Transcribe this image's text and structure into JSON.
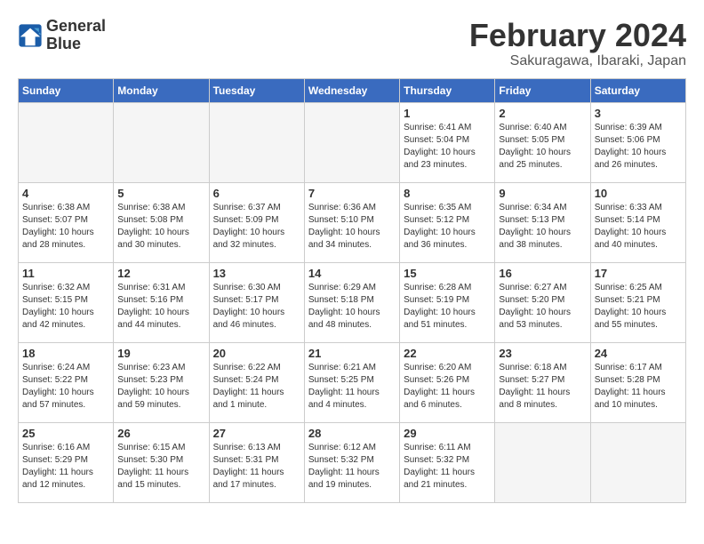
{
  "header": {
    "logo_line1": "General",
    "logo_line2": "Blue",
    "month": "February 2024",
    "location": "Sakuragawa, Ibaraki, Japan"
  },
  "weekdays": [
    "Sunday",
    "Monday",
    "Tuesday",
    "Wednesday",
    "Thursday",
    "Friday",
    "Saturday"
  ],
  "weeks": [
    [
      {
        "day": "",
        "empty": true
      },
      {
        "day": "",
        "empty": true
      },
      {
        "day": "",
        "empty": true
      },
      {
        "day": "",
        "empty": true
      },
      {
        "day": "1",
        "line1": "Sunrise: 6:41 AM",
        "line2": "Sunset: 5:04 PM",
        "line3": "Daylight: 10 hours",
        "line4": "and 23 minutes."
      },
      {
        "day": "2",
        "line1": "Sunrise: 6:40 AM",
        "line2": "Sunset: 5:05 PM",
        "line3": "Daylight: 10 hours",
        "line4": "and 25 minutes."
      },
      {
        "day": "3",
        "line1": "Sunrise: 6:39 AM",
        "line2": "Sunset: 5:06 PM",
        "line3": "Daylight: 10 hours",
        "line4": "and 26 minutes."
      }
    ],
    [
      {
        "day": "4",
        "line1": "Sunrise: 6:38 AM",
        "line2": "Sunset: 5:07 PM",
        "line3": "Daylight: 10 hours",
        "line4": "and 28 minutes."
      },
      {
        "day": "5",
        "line1": "Sunrise: 6:38 AM",
        "line2": "Sunset: 5:08 PM",
        "line3": "Daylight: 10 hours",
        "line4": "and 30 minutes."
      },
      {
        "day": "6",
        "line1": "Sunrise: 6:37 AM",
        "line2": "Sunset: 5:09 PM",
        "line3": "Daylight: 10 hours",
        "line4": "and 32 minutes."
      },
      {
        "day": "7",
        "line1": "Sunrise: 6:36 AM",
        "line2": "Sunset: 5:10 PM",
        "line3": "Daylight: 10 hours",
        "line4": "and 34 minutes."
      },
      {
        "day": "8",
        "line1": "Sunrise: 6:35 AM",
        "line2": "Sunset: 5:12 PM",
        "line3": "Daylight: 10 hours",
        "line4": "and 36 minutes."
      },
      {
        "day": "9",
        "line1": "Sunrise: 6:34 AM",
        "line2": "Sunset: 5:13 PM",
        "line3": "Daylight: 10 hours",
        "line4": "and 38 minutes."
      },
      {
        "day": "10",
        "line1": "Sunrise: 6:33 AM",
        "line2": "Sunset: 5:14 PM",
        "line3": "Daylight: 10 hours",
        "line4": "and 40 minutes."
      }
    ],
    [
      {
        "day": "11",
        "line1": "Sunrise: 6:32 AM",
        "line2": "Sunset: 5:15 PM",
        "line3": "Daylight: 10 hours",
        "line4": "and 42 minutes."
      },
      {
        "day": "12",
        "line1": "Sunrise: 6:31 AM",
        "line2": "Sunset: 5:16 PM",
        "line3": "Daylight: 10 hours",
        "line4": "and 44 minutes."
      },
      {
        "day": "13",
        "line1": "Sunrise: 6:30 AM",
        "line2": "Sunset: 5:17 PM",
        "line3": "Daylight: 10 hours",
        "line4": "and 46 minutes."
      },
      {
        "day": "14",
        "line1": "Sunrise: 6:29 AM",
        "line2": "Sunset: 5:18 PM",
        "line3": "Daylight: 10 hours",
        "line4": "and 48 minutes."
      },
      {
        "day": "15",
        "line1": "Sunrise: 6:28 AM",
        "line2": "Sunset: 5:19 PM",
        "line3": "Daylight: 10 hours",
        "line4": "and 51 minutes."
      },
      {
        "day": "16",
        "line1": "Sunrise: 6:27 AM",
        "line2": "Sunset: 5:20 PM",
        "line3": "Daylight: 10 hours",
        "line4": "and 53 minutes."
      },
      {
        "day": "17",
        "line1": "Sunrise: 6:25 AM",
        "line2": "Sunset: 5:21 PM",
        "line3": "Daylight: 10 hours",
        "line4": "and 55 minutes."
      }
    ],
    [
      {
        "day": "18",
        "line1": "Sunrise: 6:24 AM",
        "line2": "Sunset: 5:22 PM",
        "line3": "Daylight: 10 hours",
        "line4": "and 57 minutes."
      },
      {
        "day": "19",
        "line1": "Sunrise: 6:23 AM",
        "line2": "Sunset: 5:23 PM",
        "line3": "Daylight: 10 hours",
        "line4": "and 59 minutes."
      },
      {
        "day": "20",
        "line1": "Sunrise: 6:22 AM",
        "line2": "Sunset: 5:24 PM",
        "line3": "Daylight: 11 hours",
        "line4": "and 1 minute."
      },
      {
        "day": "21",
        "line1": "Sunrise: 6:21 AM",
        "line2": "Sunset: 5:25 PM",
        "line3": "Daylight: 11 hours",
        "line4": "and 4 minutes."
      },
      {
        "day": "22",
        "line1": "Sunrise: 6:20 AM",
        "line2": "Sunset: 5:26 PM",
        "line3": "Daylight: 11 hours",
        "line4": "and 6 minutes."
      },
      {
        "day": "23",
        "line1": "Sunrise: 6:18 AM",
        "line2": "Sunset: 5:27 PM",
        "line3": "Daylight: 11 hours",
        "line4": "and 8 minutes."
      },
      {
        "day": "24",
        "line1": "Sunrise: 6:17 AM",
        "line2": "Sunset: 5:28 PM",
        "line3": "Daylight: 11 hours",
        "line4": "and 10 minutes."
      }
    ],
    [
      {
        "day": "25",
        "line1": "Sunrise: 6:16 AM",
        "line2": "Sunset: 5:29 PM",
        "line3": "Daylight: 11 hours",
        "line4": "and 12 minutes."
      },
      {
        "day": "26",
        "line1": "Sunrise: 6:15 AM",
        "line2": "Sunset: 5:30 PM",
        "line3": "Daylight: 11 hours",
        "line4": "and 15 minutes."
      },
      {
        "day": "27",
        "line1": "Sunrise: 6:13 AM",
        "line2": "Sunset: 5:31 PM",
        "line3": "Daylight: 11 hours",
        "line4": "and 17 minutes."
      },
      {
        "day": "28",
        "line1": "Sunrise: 6:12 AM",
        "line2": "Sunset: 5:32 PM",
        "line3": "Daylight: 11 hours",
        "line4": "and 19 minutes."
      },
      {
        "day": "29",
        "line1": "Sunrise: 6:11 AM",
        "line2": "Sunset: 5:32 PM",
        "line3": "Daylight: 11 hours",
        "line4": "and 21 minutes."
      },
      {
        "day": "",
        "empty": true
      },
      {
        "day": "",
        "empty": true
      }
    ]
  ]
}
